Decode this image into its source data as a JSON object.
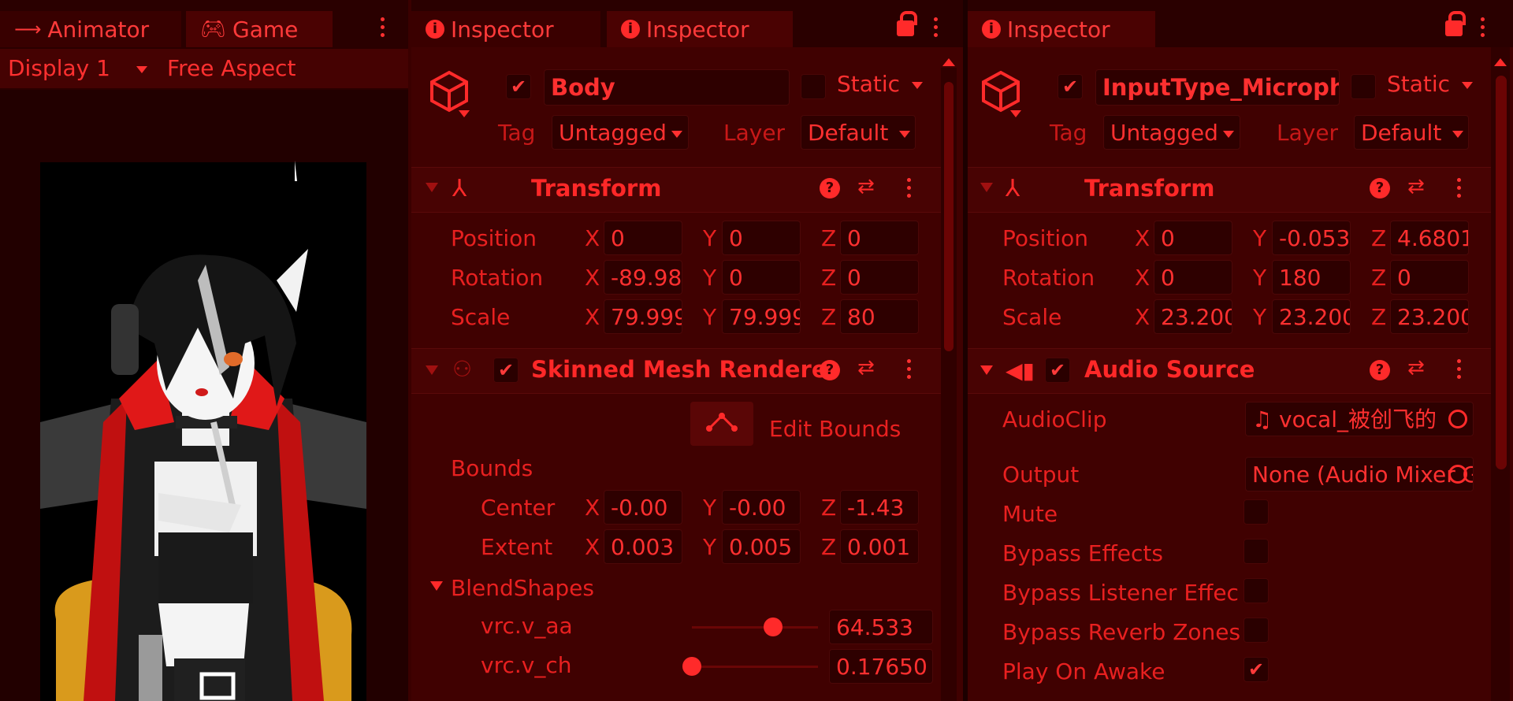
{
  "left_panel": {
    "tabs": [
      {
        "label": "Animator",
        "icon": "animator-icon"
      },
      {
        "label": "Game",
        "icon": "gamepad-icon"
      }
    ],
    "display": "Display 1",
    "aspect": "Free Aspect"
  },
  "mid_panel": {
    "tabs": [
      {
        "label": "Inspector"
      },
      {
        "label": "Inspector"
      }
    ],
    "object_name": "Body",
    "static_label": "Static",
    "tag_label": "Tag",
    "tag_value": "Untagged",
    "layer_label": "Layer",
    "layer_value": "Default",
    "transform": {
      "title": "Transform",
      "rows": [
        {
          "label": "Position",
          "x": "0",
          "y": "0",
          "z": "0"
        },
        {
          "label": "Rotation",
          "x": "-89.98",
          "y": "0",
          "z": "0"
        },
        {
          "label": "Scale",
          "x": "79.999",
          "y": "79.999",
          "z": "80"
        }
      ]
    },
    "smr": {
      "title": "Skinned Mesh Rendere",
      "edit_bounds": "Edit Bounds",
      "bounds_label": "Bounds",
      "bounds_rows": [
        {
          "label": "Center",
          "x": "-0.00",
          "y": "-0.00",
          "z": "-1.43"
        },
        {
          "label": "Extent",
          "x": "0.003",
          "y": "0.005",
          "z": "0.001"
        }
      ],
      "blendshapes_label": "BlendShapes",
      "blendshapes": [
        {
          "name": "vrc.v_aa",
          "value": "64.533",
          "level": 0.645
        },
        {
          "name": "vrc.v_ch",
          "value": "0.17650",
          "level": 0.0018
        }
      ]
    },
    "axes": {
      "x": "X",
      "y": "Y",
      "z": "Z"
    }
  },
  "right_panel": {
    "tab": "Inspector",
    "object_name": "InputType_Microphone",
    "static_label": "Static",
    "tag_label": "Tag",
    "tag_value": "Untagged",
    "layer_label": "Layer",
    "layer_value": "Default",
    "transform": {
      "title": "Transform",
      "rows": [
        {
          "label": "Position",
          "x": "0",
          "y": "-0.053",
          "z": "4.6801"
        },
        {
          "label": "Rotation",
          "x": "0",
          "y": "180",
          "z": "0"
        },
        {
          "label": "Scale",
          "x": "23.200",
          "y": "23.200",
          "z": "23.200"
        }
      ]
    },
    "audio": {
      "title": "Audio Source",
      "audioclip_label": "AudioClip",
      "audioclip_value": "vocal_被创飞的",
      "output_label": "Output",
      "output_value": "None (Audio Mixer Group)",
      "mute_label": "Mute",
      "bypass_effects_label": "Bypass Effects",
      "bypass_listener_label": "Bypass Listener Effects",
      "bypass_reverb_label": "Bypass Reverb Zones",
      "play_on_awake_label": "Play On Awake",
      "mute": false,
      "bypass_effects": false,
      "bypass_listener": false,
      "bypass_reverb": false,
      "play_on_awake": true
    }
  },
  "colors": {
    "accent": "#ff2a2a",
    "panel_bg": "#400101",
    "field_bg": "#2e0000",
    "character_stand": "#e0a020"
  }
}
